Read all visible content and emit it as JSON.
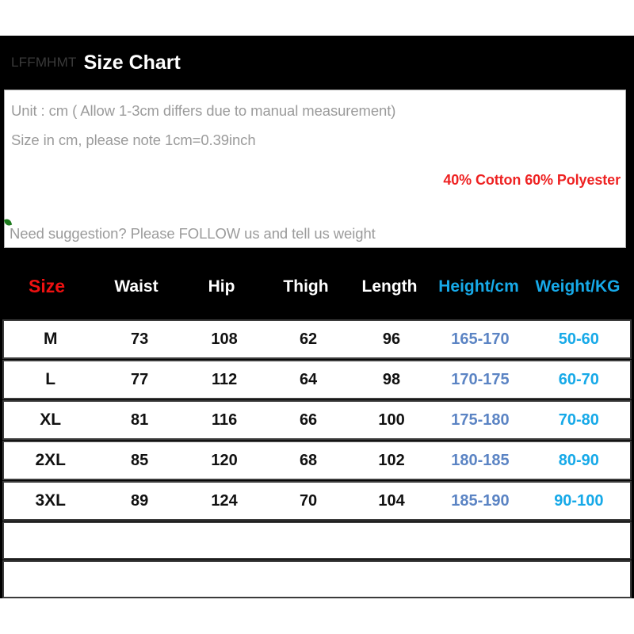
{
  "header": {
    "brand": "LFFMHMT",
    "title": "Size Chart",
    "brand_color": "#3a3a3a",
    "title_color": "#ffffff"
  },
  "info": {
    "line1": "Unit : cm ( Allow 1-3cm differs due to manual measurement)",
    "line2": "Size in cm, please note 1cm=0.39inch",
    "material": "40% Cotton 60% Polyester",
    "material_color": "#ee2222",
    "follow_note": "Need suggestion? Please FOLLOW us and tell us weight",
    "text_color": "#9b9b9b",
    "leaf_icon_color": "#1d7a1d"
  },
  "chart_data": {
    "type": "table",
    "title": "Size Chart",
    "columns": [
      "Size",
      "Waist",
      "Hip",
      "Thigh",
      "Length",
      "Height/cm",
      "Weight/KG"
    ],
    "column_colors": [
      "#ee1111",
      "#ffffff",
      "#ffffff",
      "#ffffff",
      "#ffffff",
      "#16a9e8",
      "#16a9e8"
    ],
    "rows": [
      [
        "M",
        "73",
        "108",
        "62",
        "96",
        "165-170",
        "50-60"
      ],
      [
        "L",
        "77",
        "112",
        "64",
        "98",
        "170-175",
        "60-70"
      ],
      [
        "XL",
        "81",
        "116",
        "66",
        "100",
        "175-180",
        "70-80"
      ],
      [
        "2XL",
        "85",
        "120",
        "68",
        "102",
        "180-185",
        "80-90"
      ],
      [
        "3XL",
        "89",
        "124",
        "70",
        "104",
        "185-190",
        "90-100"
      ]
    ],
    "empty_rows": 2,
    "units": "cm",
    "height_value_color": "#5b84c4",
    "weight_value_color": "#16a9e8"
  }
}
